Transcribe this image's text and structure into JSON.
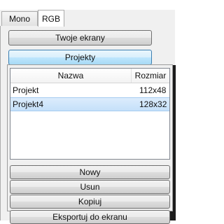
{
  "tabs": [
    {
      "label": "Mono",
      "selected": false
    },
    {
      "label": "RGB",
      "selected": true
    }
  ],
  "buttons": {
    "twoje_ekrany": "Twoje ekrany",
    "projekty": "Projekty"
  },
  "list": {
    "columns": [
      "Nazwa",
      "Rozmiar"
    ],
    "rows": [
      {
        "name": "Projekt",
        "size": "112x48",
        "selected": false
      },
      {
        "name": "Projekt4",
        "size": "128x32",
        "selected": true
      }
    ]
  },
  "actions": {
    "nowy": "Nowy",
    "usun": "Usun",
    "kopiuj": "Kopiuj",
    "eksportuj": "Eksportuj do ekranu"
  },
  "colors": {
    "selection": "#c5e0fa",
    "active_button": "#bee6fd"
  }
}
